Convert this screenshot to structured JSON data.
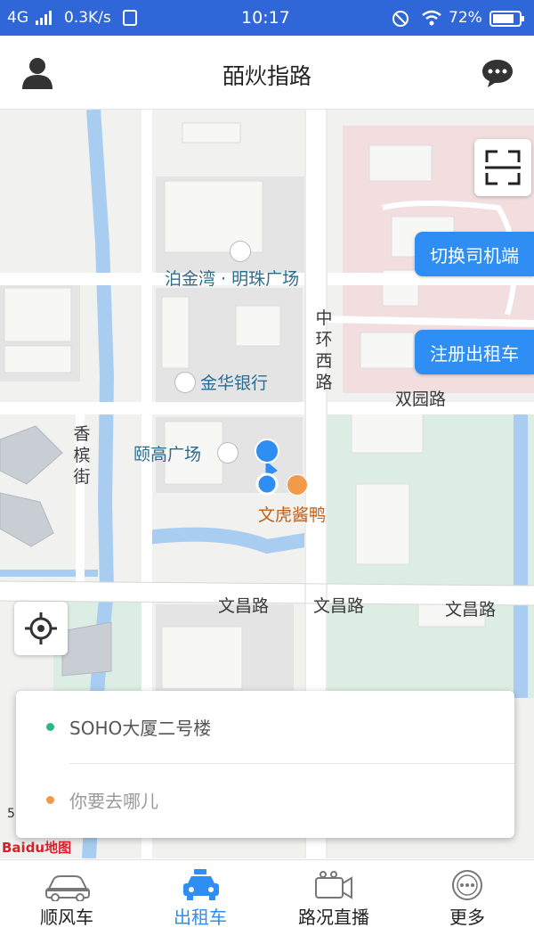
{
  "status_bar": {
    "network": "4G",
    "speed": "0.3K/s",
    "time": "10:17",
    "battery": "72%"
  },
  "header": {
    "title": "皕炏指路",
    "left_icon": "user-icon",
    "right_icon": "chat-icon"
  },
  "map": {
    "labels": {
      "plaza1": "泊金湾 · 明珠广场",
      "bank": "金华银行",
      "plaza2": "颐高广场",
      "restaurant": "文虎酱鸭",
      "road_shuangyuan": "双园路",
      "road_wenchang_1": "文昌路",
      "road_wenchang_2": "文昌路",
      "road_wenchang_3": "文昌路",
      "road_zhonghuan": "中环西路",
      "road_xiangbin": "香槟街"
    },
    "buttons": {
      "switch_driver": "切换司机端",
      "register_taxi": "注册出租车"
    },
    "scale_text": "5",
    "baidu_logo": "Baidu地图",
    "colors": {
      "water": "#a9cdf0",
      "park": "#dceee3",
      "campus": "#f2dedf",
      "accent": "#2f8ef4"
    }
  },
  "card": {
    "origin": "SOHO大厦二号楼",
    "destination_placeholder": "你要去哪儿",
    "origin_dot_color": "#2bb58e",
    "dest_dot_color": "#f29a4a"
  },
  "bottom_nav": {
    "tabs": [
      {
        "label": "顺风车",
        "icon": "car-icon",
        "active": false
      },
      {
        "label": "出租车",
        "icon": "taxi-icon",
        "active": true
      },
      {
        "label": "路况直播",
        "icon": "camera-icon",
        "active": false
      },
      {
        "label": "更多",
        "icon": "more-icon",
        "active": false
      }
    ]
  }
}
